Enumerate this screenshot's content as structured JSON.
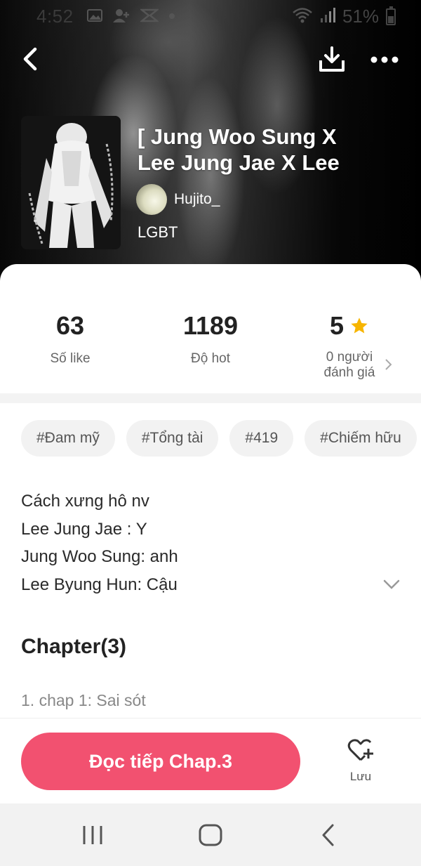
{
  "status_bar": {
    "time": "4:52",
    "battery": "51%",
    "icons": [
      "image-icon",
      "add-contact-icon",
      "capcut-icon",
      "dot-icon",
      "wifi-icon",
      "signal-icon",
      "battery-icon"
    ]
  },
  "header": {
    "back_icon": "back-arrow-icon",
    "download_icon": "download-icon",
    "more_icon": "more-dots-icon"
  },
  "story": {
    "title": "[ Jung Woo Sung X\nLee Jung Jae X Lee",
    "author": "Hujito_",
    "category": "LGBT"
  },
  "stats": [
    {
      "value": "63",
      "label": "Số like"
    },
    {
      "value": "1189",
      "label": "Độ hot"
    },
    {
      "value": "5",
      "label": "0 người\nđánh giá",
      "icon": "star-icon",
      "icon_color": "#f7b500"
    }
  ],
  "tags": [
    "#Đam mỹ",
    "#Tổng tài",
    "#419",
    "#Chiếm hữu"
  ],
  "description": [
    "Cách xưng hô nv",
    "Lee Jung Jae : Y",
    "Jung Woo Sung: anh",
    "Lee Byung Hun: Cậu"
  ],
  "chapters": {
    "heading": "Chapter(3)",
    "items": [
      "1. chap 1: Sai sót"
    ]
  },
  "bottom_bar": {
    "read_button": "Đọc tiếp Chap.3",
    "save_label": "Lưu"
  },
  "colors": {
    "accent": "#f25170",
    "star": "#f7b500",
    "tag_bg": "#f2f2f2"
  }
}
